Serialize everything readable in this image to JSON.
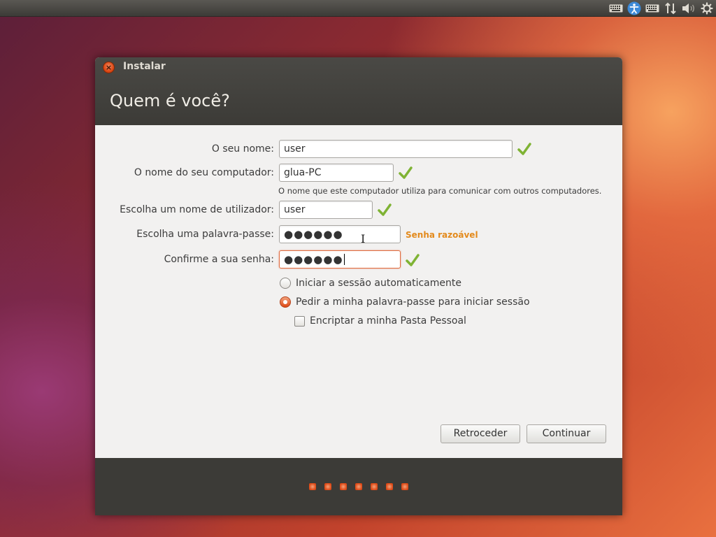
{
  "window": {
    "title": "Instalar",
    "page_title": "Quem é você?"
  },
  "form": {
    "name_label": "O seu nome:",
    "name_value": "user",
    "computer_label": "O nome do seu computador:",
    "computer_value": "glua-PC",
    "computer_hint": "O nome que este computador utiliza para comunicar com outros computadores.",
    "username_label": "Escolha um nome de utilizador:",
    "username_value": "user",
    "password_label": "Escolha uma palavra-passe:",
    "password_value": "●●●●●●",
    "password_strength": "Senha razoável",
    "confirm_label": "Confirme a sua senha:",
    "confirm_value": "●●●●●●"
  },
  "options": {
    "auto_login_label": "Iniciar a sessão automaticamente",
    "auto_login_selected": false,
    "require_password_label": "Pedir a minha palavra-passe para iniciar sessão",
    "require_password_selected": true,
    "encrypt_label": "Encriptar a minha Pasta Pessoal",
    "encrypt_checked": false
  },
  "buttons": {
    "back_label": "Retroceder",
    "continue_label": "Continuar"
  },
  "progress": {
    "total_steps": 7
  },
  "tray": {
    "icons": [
      "keyboard-icon",
      "accessibility-icon",
      "keyboard-layout-icon",
      "network-icon",
      "volume-icon",
      "settings-gear-icon"
    ]
  },
  "colors": {
    "accent": "#dd4814",
    "check": "#7fb334",
    "strength": "#e38a1c",
    "header": "#3c3b37"
  }
}
